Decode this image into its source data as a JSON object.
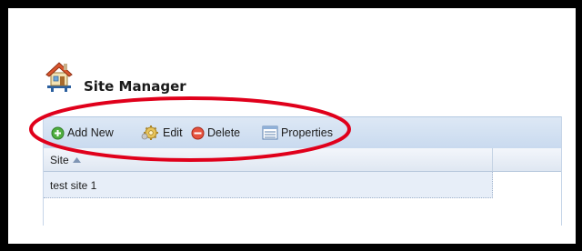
{
  "page": {
    "title": "Site Manager",
    "title_icon": "house-icon"
  },
  "toolbar": {
    "add_new_label": "Add New",
    "add_new_icon": "plus-circle-icon",
    "edit_label": "Edit",
    "edit_icon": "gear-icon",
    "delete_label": "Delete",
    "delete_icon": "minus-circle-icon",
    "properties_label": "Properties",
    "properties_icon": "properties-list-icon"
  },
  "grid": {
    "columns": [
      {
        "label": "Site",
        "sort": "ascending",
        "sort_icon": "sort-up-icon"
      }
    ],
    "rows": [
      {
        "site": "test site 1"
      }
    ]
  },
  "annotation": {
    "type": "ellipse",
    "color": "#e0001b",
    "encloses": "toolbar"
  }
}
